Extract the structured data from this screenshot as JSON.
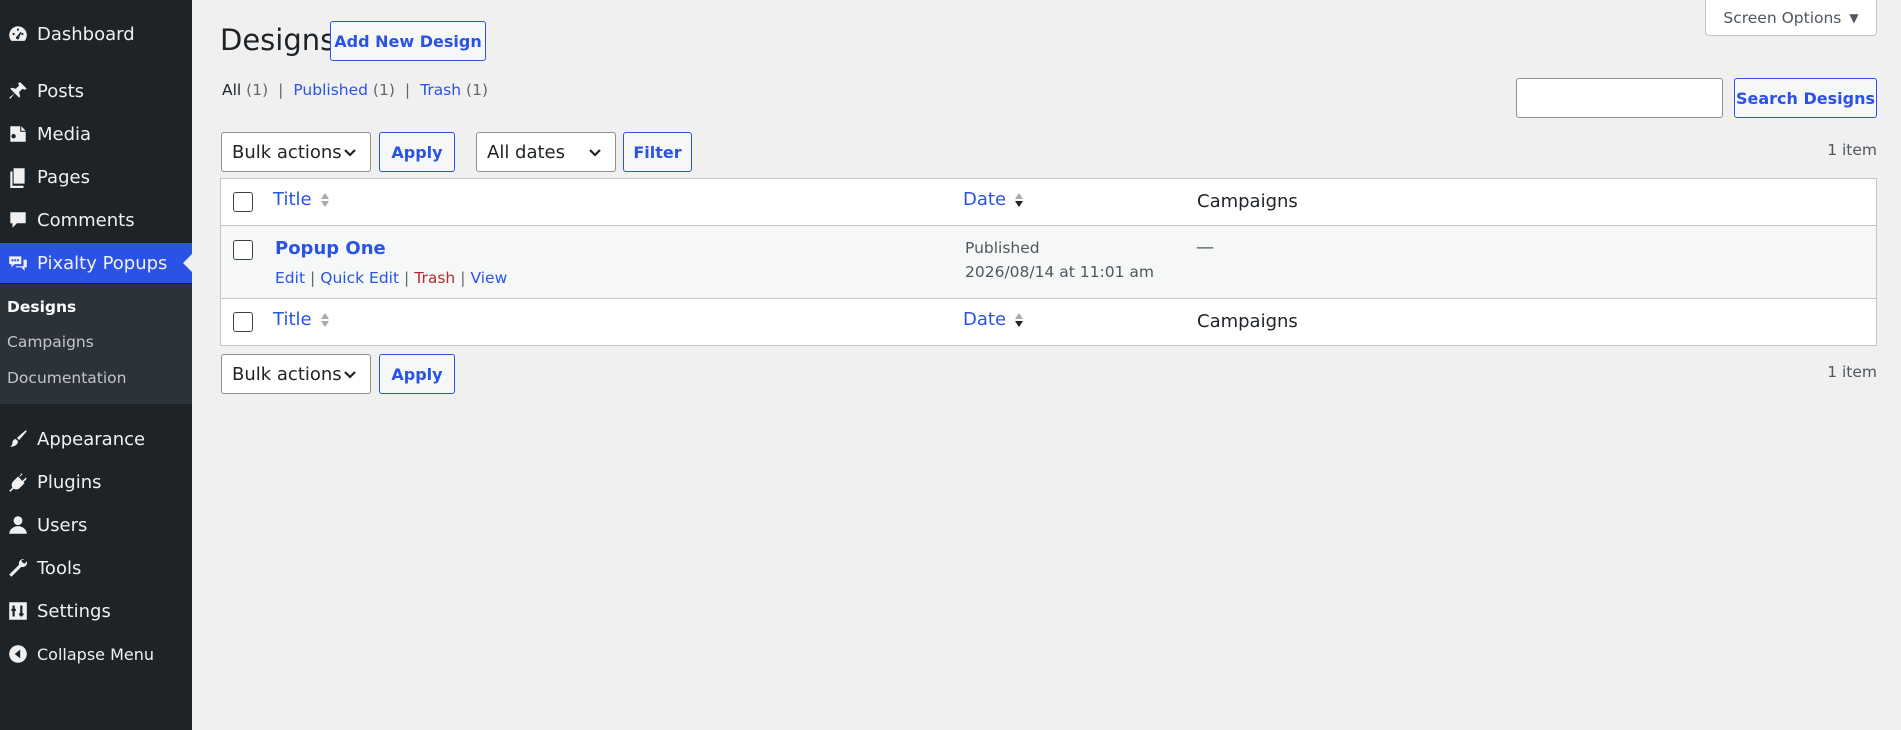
{
  "sidebar": {
    "items": [
      {
        "label": "Dashboard",
        "icon": "dashboard-icon"
      },
      {
        "label": "Posts",
        "icon": "pin-icon"
      },
      {
        "label": "Media",
        "icon": "media-icon"
      },
      {
        "label": "Pages",
        "icon": "pages-icon"
      },
      {
        "label": "Comments",
        "icon": "comment-icon"
      },
      {
        "label": "Pixalty Popups",
        "icon": "chat-bubbles-icon",
        "current": true
      },
      {
        "label": "Appearance",
        "icon": "paintbrush-icon"
      },
      {
        "label": "Plugins",
        "icon": "plugin-icon"
      },
      {
        "label": "Users",
        "icon": "user-icon"
      },
      {
        "label": "Tools",
        "icon": "wrench-icon"
      },
      {
        "label": "Settings",
        "icon": "sliders-icon"
      }
    ],
    "submenu": [
      "Designs",
      "Campaigns",
      "Documentation"
    ],
    "collapse_label": "Collapse Menu"
  },
  "header": {
    "title": "Designs",
    "add_new_label": "Add New Design",
    "screen_options_label": "Screen Options",
    "screen_options_arrow": "▼"
  },
  "filters": {
    "all_label": "All",
    "all_count": "(1)",
    "published_label": "Published",
    "published_count": "(1)",
    "trash_label": "Trash",
    "trash_count": "(1)",
    "separator": "|"
  },
  "search": {
    "value": "",
    "button_label": "Search Designs"
  },
  "tablenav": {
    "bulk_actions": "Bulk actions",
    "apply_label": "Apply",
    "dates": "All dates",
    "filter_label": "Filter",
    "count": "1 item"
  },
  "table": {
    "columns": {
      "title": "Title",
      "date": "Date",
      "campaigns": "Campaigns"
    },
    "rows": [
      {
        "title": "Popup One",
        "actions": {
          "edit": "Edit",
          "quick_edit": "Quick Edit",
          "trash": "Trash",
          "view": "View"
        },
        "status": "Published",
        "date": "2026/08/14 at 11:01 am",
        "campaigns": "—"
      }
    ]
  },
  "colors": {
    "accent": "#2a53e5",
    "sidebar_bg": "#1d2327",
    "background": "#f0f0f1",
    "trash": "#b32d2e"
  }
}
